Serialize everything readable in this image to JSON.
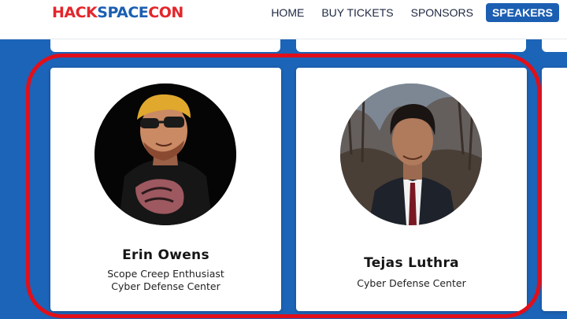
{
  "header": {
    "logo": {
      "part1": "HACK",
      "part2": "SPACE",
      "part3": "CON"
    },
    "nav": [
      {
        "label": "HOME"
      },
      {
        "label": "BUY TICKETS"
      },
      {
        "label": "SPONSORS"
      },
      {
        "label": "SPEAKERS",
        "active": true
      }
    ]
  },
  "speakers": [
    {
      "name": "Erin Owens",
      "roles": [
        "Scope Creep Enthusiast",
        "Cyber Defense Center"
      ]
    },
    {
      "name": "Tejas Luthra",
      "roles": [
        "Cyber Defense Center"
      ]
    }
  ],
  "colors": {
    "background": "#1c64b8",
    "brand_red": "#e3262b",
    "brand_blue": "#1c5fb2",
    "highlight": "#e10f1a"
  }
}
